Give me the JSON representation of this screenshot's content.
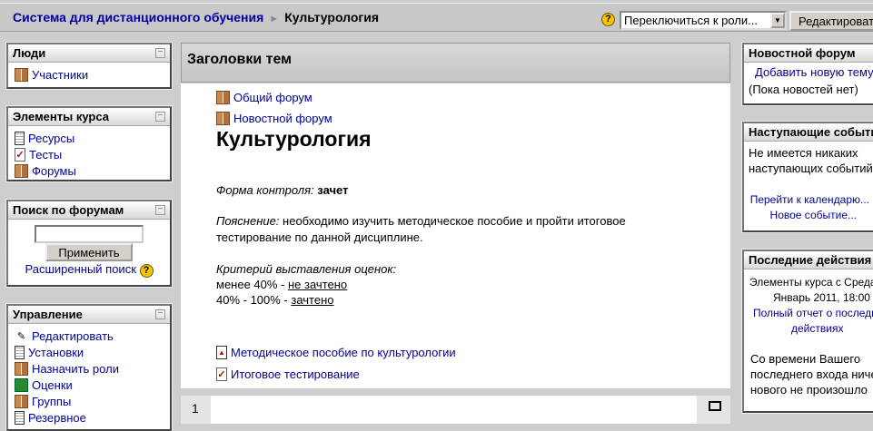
{
  "nav": {
    "site": "Система для дистанционного обучения",
    "sep": "►",
    "course": "Культурология",
    "role_select": "Переключиться к роли...",
    "edit_button": "Редактировать"
  },
  "left": {
    "people": {
      "title": "Люди",
      "items": [
        "Участники"
      ]
    },
    "activities": {
      "title": "Элементы курса",
      "items": [
        "Ресурсы",
        "Тесты",
        "Форумы"
      ]
    },
    "search": {
      "title": "Поиск по форумам",
      "input": "",
      "apply": "Применить",
      "advanced": "Расширенный поиск"
    },
    "admin": {
      "title": "Управление",
      "items": [
        "Редактировать",
        "Установки",
        "Назначить роли",
        "Оценки",
        "Группы",
        "Резервное"
      ]
    }
  },
  "center": {
    "title": "Заголовки тем",
    "forum1": "Общий форум",
    "forum2": "Новостной форум",
    "course_title": "Культурология",
    "control_label": "Форма контроля:",
    "control_value": "зачет",
    "expl_label": "Пояснение:",
    "expl_text": "необходимо изучить методическое пособие и пройти итоговое",
    "expl_text2": "тестирование по данной дисциплине.",
    "crit_label": "Критерий выставления оценок:",
    "crit1_a": "менее 40% - ",
    "crit1_b": "не зачтено",
    "crit2_a": "40% - 100% - ",
    "crit2_b": "зачтено",
    "res1": "Методическое пособие по культурологии",
    "res2": "Итоговое тестирование",
    "section_num": "1"
  },
  "right": {
    "news": {
      "title": "Новостной форум",
      "add": "Добавить новую тему...",
      "none": "(Пока новостей нет)"
    },
    "events": {
      "title": "Наступающие события",
      "none1": "Не имеется никаких",
      "none2": "наступающих событий",
      "calendar": "Перейти к календарю...",
      "new_event": "Новое событие..."
    },
    "recent": {
      "title": "Последние действия",
      "since1": "Элементы курса с Среда",
      "since2": "Январь 2011, 18:00",
      "report1": "Полный отчет о последних",
      "report2": "действиях",
      "nothing1": "Со времени Вашего",
      "nothing2": "последнего входа ничего",
      "nothing3": "нового не произошло"
    }
  }
}
